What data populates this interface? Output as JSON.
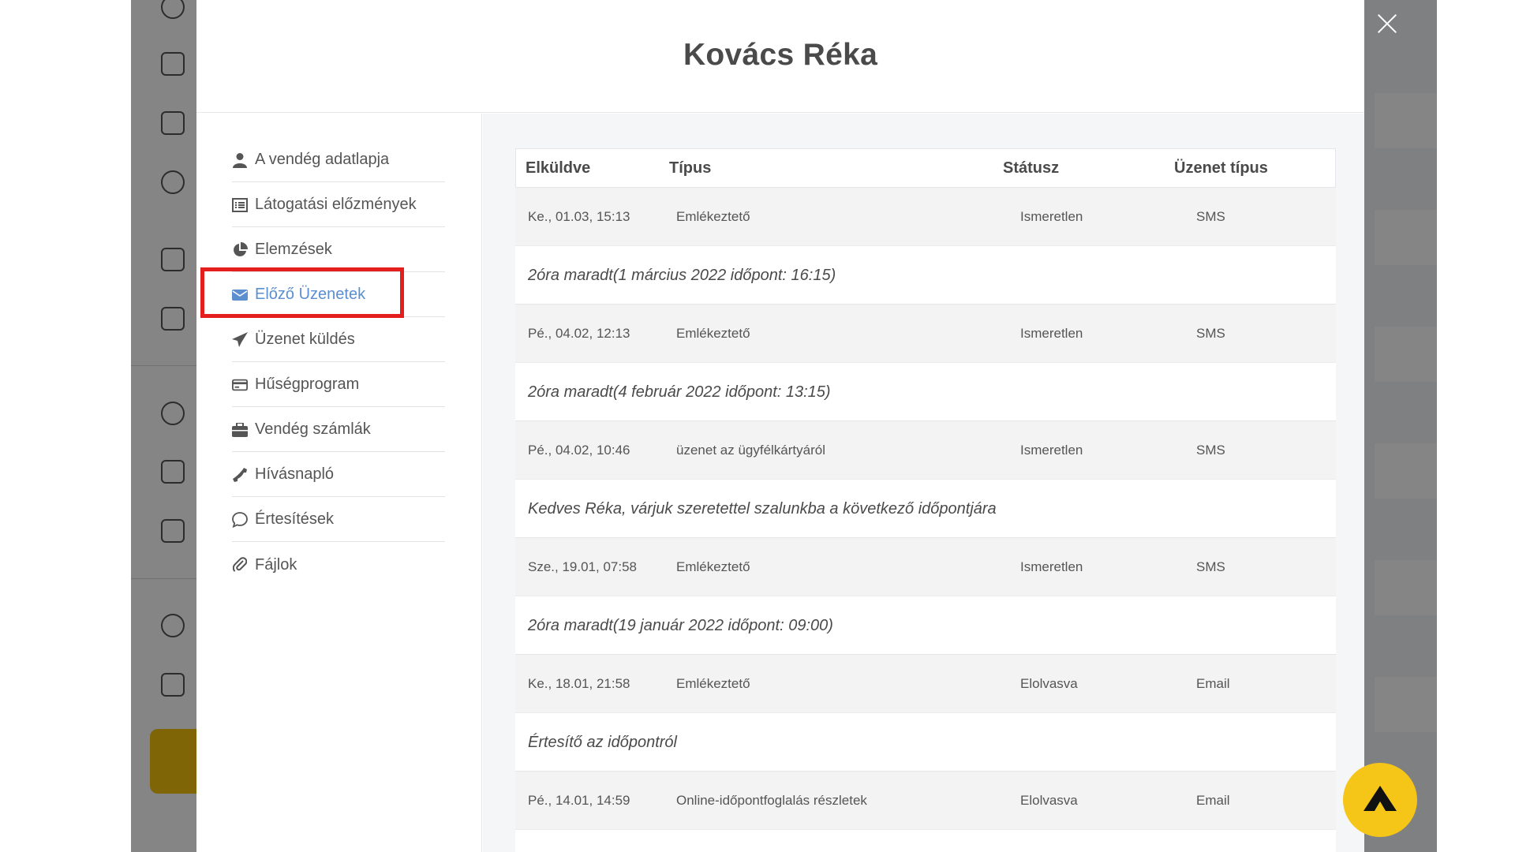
{
  "modal": {
    "title": "Kovács Réka"
  },
  "nav": {
    "items": [
      {
        "label": "A vendég adatlapja",
        "icon": "user-icon"
      },
      {
        "label": "Látogatási előzmények",
        "icon": "list-icon"
      },
      {
        "label": "Elemzések",
        "icon": "pie-chart-icon"
      },
      {
        "label": "Előző Üzenetek",
        "icon": "envelope-icon",
        "active": true
      },
      {
        "label": "Üzenet küldés",
        "icon": "paper-plane-icon"
      },
      {
        "label": "Hűségprogram",
        "icon": "credit-card-icon"
      },
      {
        "label": "Vendég számlák",
        "icon": "briefcase-icon"
      },
      {
        "label": "Hívásnapló",
        "icon": "phone-icon"
      },
      {
        "label": "Értesítések",
        "icon": "chat-bubble-icon"
      },
      {
        "label": "Fájlok",
        "icon": "paperclip-icon"
      }
    ]
  },
  "table": {
    "headers": {
      "sent": "Elküldve",
      "type": "Típus",
      "status": "Státusz",
      "msg_type": "Üzenet típus"
    },
    "rows": [
      {
        "sent": "Ke., 01.03, 15:13",
        "type": "Emlékeztető",
        "status": "Ismeretlen",
        "msg_type": "SMS",
        "text": "2óra maradt(1 március 2022 időpont: 16:15)"
      },
      {
        "sent": "Pé., 04.02, 12:13",
        "type": "Emlékeztető",
        "status": "Ismeretlen",
        "msg_type": "SMS",
        "text": "2óra maradt(4 február 2022 időpont: 13:15)"
      },
      {
        "sent": "Pé., 04.02, 10:46",
        "type": "üzenet az ügyfélkártyáról",
        "status": "Ismeretlen",
        "msg_type": "SMS",
        "text": "Kedves Réka, várjuk szeretettel szalunkba a következő időpontjára"
      },
      {
        "sent": "Sze., 19.01, 07:58",
        "type": "Emlékeztető",
        "status": "Ismeretlen",
        "msg_type": "SMS",
        "text": "2óra maradt(19 január 2022 időpont: 09:00)"
      },
      {
        "sent": "Ke., 18.01, 21:58",
        "type": "Emlékeztető",
        "status": "Elolvasva",
        "msg_type": "Email",
        "text": "Értesítő az időpontról"
      },
      {
        "sent": "Pé., 14.01, 14:59",
        "type": "Online-időpontfoglalás részletek",
        "status": "Elolvasva",
        "msg_type": "Email",
        "text": ""
      }
    ]
  },
  "colors": {
    "accent": "#5b8fd0",
    "highlight": "#e41d1d",
    "fab": "#f5c518"
  }
}
